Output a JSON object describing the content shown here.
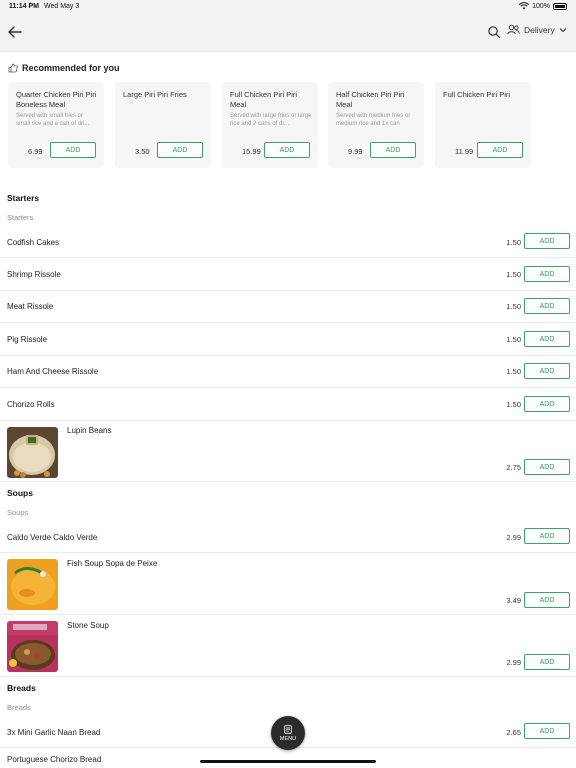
{
  "status_bar": {
    "time": "11:14 PM",
    "date": "Wed May 3",
    "battery": "100%"
  },
  "header": {
    "delivery_label": "Delivery",
    "icons": [
      "back-arrow-icon",
      "search-icon",
      "users-icon",
      "chevron-down-icon"
    ]
  },
  "recommended": {
    "title": "Recommended for you",
    "cards": [
      {
        "title": "Quarter Chicken Piri Piri Boneless Meal",
        "desc": "Served with small fries or small rice and a can of dri...",
        "price": "6.99",
        "add": "ADD"
      },
      {
        "title": "Large Piri Piri Fries",
        "desc": "",
        "price": "3.50",
        "add": "ADD"
      },
      {
        "title": "Full Chicken Piri Piri Meal",
        "desc": "Served with large fries or large rice and 2 cans of dr...",
        "price": "15.99",
        "add": "ADD"
      },
      {
        "title": "Half Chicken Piri Piri Meal",
        "desc": "Served with medium fries or medium rice and 1x can",
        "price": "9.99",
        "add": "ADD"
      },
      {
        "title": "Full Chicken Piri Piri",
        "desc": "",
        "price": "11.99",
        "add": "ADD"
      }
    ]
  },
  "starters": {
    "heading": "Starters",
    "sub": "Starters",
    "items": [
      {
        "name": "Codfish Cakes",
        "price": "1.50",
        "add": "ADD"
      },
      {
        "name": "Shrimp Rissole",
        "price": "1.50",
        "add": "ADD"
      },
      {
        "name": "Meat Rissole",
        "price": "1.50",
        "add": "ADD"
      },
      {
        "name": "Pig Rissole",
        "price": "1.50",
        "add": "ADD"
      },
      {
        "name": "Ham And Cheese Rissole",
        "price": "1.50",
        "add": "ADD"
      },
      {
        "name": "Chorizo Rolls",
        "price": "1.50",
        "add": "ADD"
      },
      {
        "name": "Lupin Beans",
        "price": "2.75",
        "add": "ADD"
      }
    ]
  },
  "soups": {
    "heading": "Soups",
    "sub": "Soups",
    "items": [
      {
        "name": "Caldo Verde Caldo Verde",
        "price": "2.99",
        "add": "ADD"
      },
      {
        "name": "Fish Soup Sopa de Peixe",
        "price": "3.49",
        "add": "ADD"
      },
      {
        "name": "Stone Soup",
        "price": "2.99",
        "add": "ADD"
      }
    ]
  },
  "breads": {
    "heading": "Breads",
    "sub": "Breads",
    "items": [
      {
        "name": "3x Mini Garlic Naan Bread",
        "price": "2.65",
        "add": "ADD"
      },
      {
        "name": "Portuguese Chorizo Bread",
        "price": "",
        "add": ""
      }
    ]
  },
  "menu_button": {
    "label": "MENU"
  },
  "colors": {
    "accent": "#2e9a59",
    "header_bg": "#f3f3f3",
    "card_bg": "#f6f6f6",
    "menu_bg": "#2b2b2b"
  }
}
